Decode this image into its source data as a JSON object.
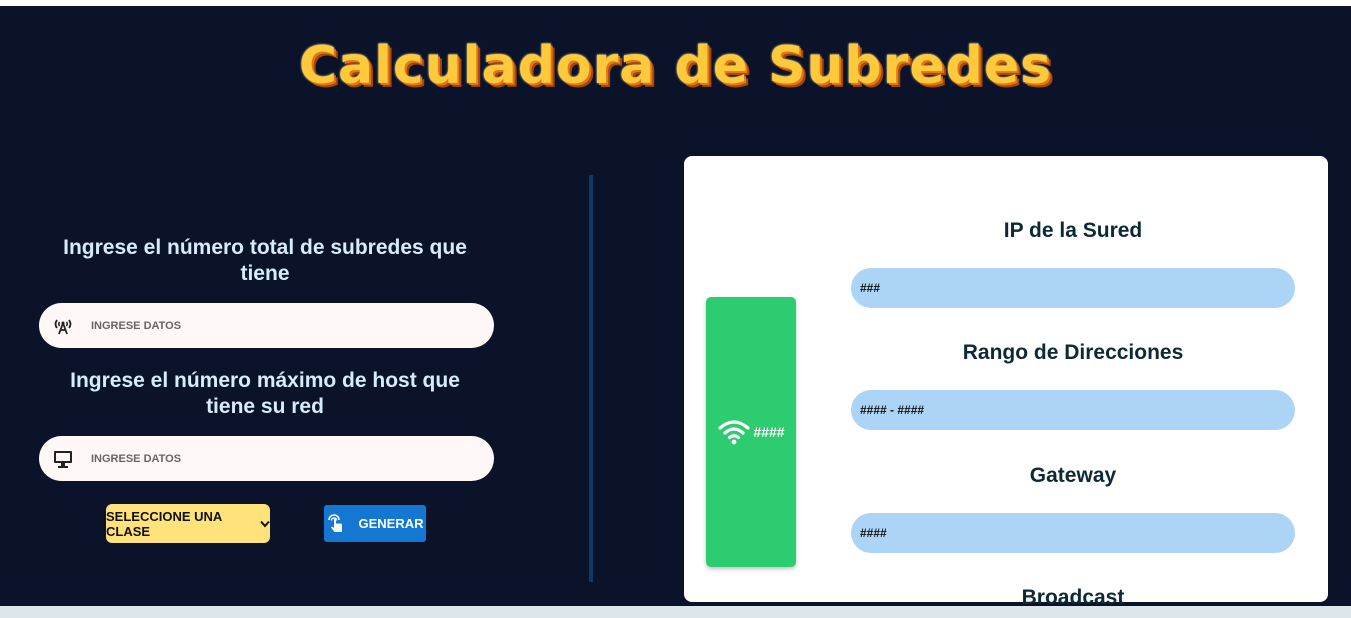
{
  "header": {
    "title": "Calculadora de Subredes"
  },
  "form": {
    "subnets_label": "Ingrese el número total de subredes que tiene",
    "subnets_placeholder": "INGRESE DATOS",
    "hosts_label": "Ingrese el número máximo de host que tiene su red",
    "hosts_placeholder": "INGRESE DATOS",
    "class_select": {
      "selected": "SELECCIONE UNA CLASE"
    },
    "generate_label": "GENERAR"
  },
  "result": {
    "badge_value": "####",
    "fields": [
      {
        "title": "IP de la Sured",
        "value": "###"
      },
      {
        "title": "Rango de Direcciones",
        "value": "#### - ####"
      },
      {
        "title": "Gateway",
        "value": "####"
      },
      {
        "title": "Broadcast"
      }
    ]
  },
  "icons": {
    "subnets_input": "antenna-icon",
    "hosts_input": "monitor-icon",
    "generate": "touch-icon",
    "badge": "wifi-icon"
  },
  "colors": {
    "background": "#0b132b",
    "title": "#ffc93c",
    "select": "#ffe27a",
    "button": "#1478d2",
    "badge": "#2ecc71",
    "field": "#acd4f6"
  }
}
